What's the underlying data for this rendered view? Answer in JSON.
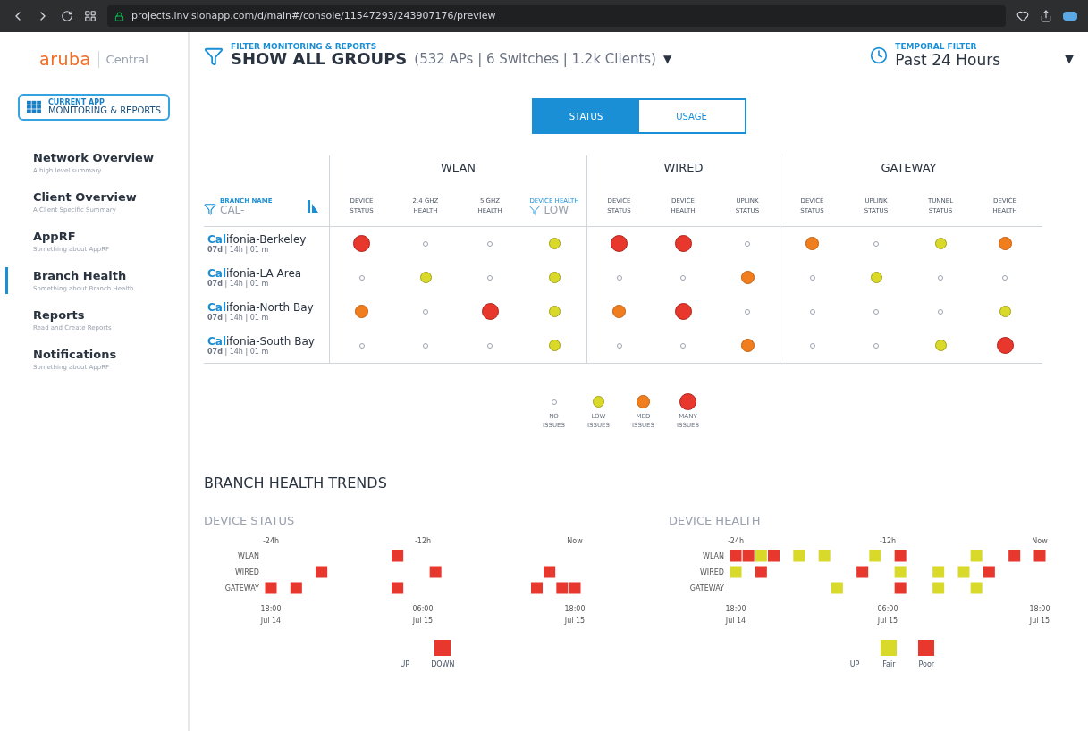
{
  "browser": {
    "url": "projects.invisionapp.com/d/main#/console/11547293/243907176/preview"
  },
  "sidebar": {
    "logo": "aruba",
    "product": "Central",
    "current_app": {
      "label": "CURRENT APP",
      "name": "MONITORING & REPORTS"
    },
    "items": [
      {
        "title": "Network Overview",
        "subtitle": "A high level summary",
        "selected": false
      },
      {
        "title": "Client Overview",
        "subtitle": "A Client Specific Summary",
        "selected": false
      },
      {
        "title": "AppRF",
        "subtitle": "Something about AppRF",
        "selected": false
      },
      {
        "title": "Branch Health",
        "subtitle": "Something about Branch Health",
        "selected": true
      },
      {
        "title": "Reports",
        "subtitle": "Read and Create Reports",
        "selected": false
      },
      {
        "title": "Notifications",
        "subtitle": "Something about AppRF",
        "selected": false
      }
    ]
  },
  "header": {
    "filter_label": "FILTER MONITORING & REPORTS",
    "group": "SHOW ALL GROUPS",
    "counts": "(532 APs | 6 Switches | 1.2k Clients)",
    "caret": "▼",
    "temporal_label": "TEMPORAL FILTER",
    "temporal_value": "Past 24 Hours",
    "menu_caret": "▼"
  },
  "view_tabs": [
    {
      "label": "STATUS",
      "selected": true
    },
    {
      "label": "USAGE",
      "selected": false
    }
  ],
  "table": {
    "branch_filter": {
      "label": "BRANCH NAME",
      "value": "CAL-"
    },
    "groups": [
      {
        "name": "WLAN",
        "columns": [
          {
            "label": "DEVICE STATUS"
          },
          {
            "label": "2.4 GHZ HEALTH"
          },
          {
            "label": "5 GHZ HEALTH"
          },
          {
            "label": "DEVICE HEALTH",
            "filter": "LOW"
          }
        ]
      },
      {
        "name": "WIRED",
        "columns": [
          {
            "label": "DEVICE STATUS"
          },
          {
            "label": "DEVICE HEALTH"
          },
          {
            "label": "UPLINK STATUS"
          }
        ]
      },
      {
        "name": "GATEWAY",
        "columns": [
          {
            "label": "DEVICE STATUS"
          },
          {
            "label": "UPLINK STATUS"
          },
          {
            "label": "TUNNEL STATUS"
          },
          {
            "label": "DEVICE HEALTH"
          }
        ]
      }
    ],
    "rows": [
      {
        "match": "Cal",
        "rest": "ifonia-Berkeley",
        "uptime": "**07d** | 14h | 01 m",
        "cells": [
          {
            "kind": "many"
          },
          {
            "kind": "none"
          },
          {
            "kind": "none"
          },
          {
            "kind": "low"
          },
          {
            "kind": "many"
          },
          {
            "kind": "many"
          },
          {
            "kind": "none"
          },
          {
            "kind": "med"
          },
          {
            "kind": "none"
          },
          {
            "kind": "low"
          },
          {
            "kind": "med"
          }
        ]
      },
      {
        "match": "Cal",
        "rest": "ifonia-LA Area",
        "uptime": "**07d** | 14h | 01 m",
        "cells": [
          {
            "kind": "none"
          },
          {
            "kind": "low"
          },
          {
            "kind": "none"
          },
          {
            "kind": "low"
          },
          {
            "kind": "none"
          },
          {
            "kind": "none"
          },
          {
            "kind": "med"
          },
          {
            "kind": "none"
          },
          {
            "kind": "low"
          },
          {
            "kind": "none"
          },
          {
            "kind": "none"
          }
        ]
      },
      {
        "match": "Cal",
        "rest": "ifonia-North Bay",
        "uptime": "**07d** | 14h | 01 m",
        "cells": [
          {
            "kind": "med"
          },
          {
            "kind": "none"
          },
          {
            "kind": "many"
          },
          {
            "kind": "low"
          },
          {
            "kind": "med"
          },
          {
            "kind": "many"
          },
          {
            "kind": "none"
          },
          {
            "kind": "none"
          },
          {
            "kind": "none"
          },
          {
            "kind": "none"
          },
          {
            "kind": "low"
          }
        ]
      },
      {
        "match": "Cal",
        "rest": "ifonia-South Bay",
        "uptime": "**07d** | 14h | 01 m",
        "cells": [
          {
            "kind": "none"
          },
          {
            "kind": "none"
          },
          {
            "kind": "none"
          },
          {
            "kind": "low"
          },
          {
            "kind": "none"
          },
          {
            "kind": "none"
          },
          {
            "kind": "med"
          },
          {
            "kind": "none"
          },
          {
            "kind": "none"
          },
          {
            "kind": "low"
          },
          {
            "kind": "many"
          }
        ]
      }
    ]
  },
  "legend": [
    {
      "kind": "none",
      "label": "NO ISSUES"
    },
    {
      "kind": "low",
      "label": "LOW ISSUES"
    },
    {
      "kind": "med",
      "label": "MED ISSUES"
    },
    {
      "kind": "many",
      "label": "MANY ISSUES"
    }
  ],
  "trends": {
    "title": "BRANCH HEALTH TRENDS",
    "charts": [
      {
        "title": "DEVICE STATUS",
        "top_labels": [
          "-24h",
          "-12h",
          "Now"
        ],
        "bottom_labels": [
          {
            "time": "18:00",
            "date": "Jul 14"
          },
          {
            "time": "06:00",
            "date": "Jul 15"
          },
          {
            "time": "18:00",
            "date": "Jul 15"
          }
        ],
        "rows": [
          {
            "label": "WLAN",
            "cells": [
              {
                "kind": "up"
              },
              {
                "kind": "up"
              },
              {
                "kind": "up"
              },
              {
                "kind": "up"
              },
              {
                "kind": "up"
              },
              {
                "kind": "up"
              },
              {
                "kind": "up"
              },
              {
                "kind": "up"
              },
              {
                "kind": "up"
              },
              {
                "kind": "up"
              },
              {
                "kind": "down"
              },
              {
                "kind": "up"
              },
              {
                "kind": "up"
              },
              {
                "kind": "up"
              },
              {
                "kind": "up"
              },
              {
                "kind": "up"
              },
              {
                "kind": "up"
              },
              {
                "kind": "up"
              },
              {
                "kind": "up"
              },
              {
                "kind": "up"
              },
              {
                "kind": "up"
              },
              {
                "kind": "up"
              },
              {
                "kind": "up"
              },
              {
                "kind": "up"
              },
              {
                "kind": "up"
              }
            ]
          },
          {
            "label": "WIRED",
            "cells": [
              {
                "kind": "up"
              },
              {
                "kind": "up"
              },
              {
                "kind": "up"
              },
              {
                "kind": "up"
              },
              {
                "kind": "down"
              },
              {
                "kind": "up"
              },
              {
                "kind": "up"
              },
              {
                "kind": "up"
              },
              {
                "kind": "up"
              },
              {
                "kind": "up"
              },
              {
                "kind": "up"
              },
              {
                "kind": "up"
              },
              {
                "kind": "up"
              },
              {
                "kind": "down"
              },
              {
                "kind": "up"
              },
              {
                "kind": "up"
              },
              {
                "kind": "up"
              },
              {
                "kind": "up"
              },
              {
                "kind": "up"
              },
              {
                "kind": "up"
              },
              {
                "kind": "up"
              },
              {
                "kind": "up"
              },
              {
                "kind": "down"
              },
              {
                "kind": "up"
              },
              {
                "kind": "up"
              }
            ]
          },
          {
            "label": "GATEWAY",
            "cells": [
              {
                "kind": "down"
              },
              {
                "kind": "up"
              },
              {
                "kind": "down"
              },
              {
                "kind": "up"
              },
              {
                "kind": "up"
              },
              {
                "kind": "up"
              },
              {
                "kind": "up"
              },
              {
                "kind": "up"
              },
              {
                "kind": "up"
              },
              {
                "kind": "up"
              },
              {
                "kind": "down"
              },
              {
                "kind": "up"
              },
              {
                "kind": "up"
              },
              {
                "kind": "up"
              },
              {
                "kind": "up"
              },
              {
                "kind": "up"
              },
              {
                "kind": "up"
              },
              {
                "kind": "up"
              },
              {
                "kind": "up"
              },
              {
                "kind": "up"
              },
              {
                "kind": "up"
              },
              {
                "kind": "down"
              },
              {
                "kind": "up"
              },
              {
                "kind": "down"
              },
              {
                "kind": "down"
              }
            ]
          }
        ],
        "legend": [
          {
            "kind": "up",
            "label": "UP"
          },
          {
            "kind": "down",
            "label": "DOWN"
          }
        ]
      },
      {
        "title": "DEVICE HEALTH",
        "top_labels": [
          "-24h",
          "-12h",
          "Now"
        ],
        "bottom_labels": [
          {
            "time": "18:00",
            "date": "Jul 14"
          },
          {
            "time": "06:00",
            "date": "Jul 15"
          },
          {
            "time": "18:00",
            "date": "Jul 15"
          }
        ],
        "rows": [
          {
            "label": "WLAN",
            "cells": [
              {
                "kind": "poor"
              },
              {
                "kind": "poor"
              },
              {
                "kind": "fair"
              },
              {
                "kind": "poor"
              },
              {
                "kind": "up"
              },
              {
                "kind": "fair"
              },
              {
                "kind": "up"
              },
              {
                "kind": "fair"
              },
              {
                "kind": "up"
              },
              {
                "kind": "up"
              },
              {
                "kind": "up"
              },
              {
                "kind": "fair"
              },
              {
                "kind": "up"
              },
              {
                "kind": "poor"
              },
              {
                "kind": "up"
              },
              {
                "kind": "up"
              },
              {
                "kind": "up"
              },
              {
                "kind": "up"
              },
              {
                "kind": "up"
              },
              {
                "kind": "fair"
              },
              {
                "kind": "up"
              },
              {
                "kind": "up"
              },
              {
                "kind": "poor"
              },
              {
                "kind": "up"
              },
              {
                "kind": "poor"
              }
            ]
          },
          {
            "label": "WIRED",
            "cells": [
              {
                "kind": "fair"
              },
              {
                "kind": "up"
              },
              {
                "kind": "poor"
              },
              {
                "kind": "up"
              },
              {
                "kind": "up"
              },
              {
                "kind": "up"
              },
              {
                "kind": "up"
              },
              {
                "kind": "up"
              },
              {
                "kind": "up"
              },
              {
                "kind": "up"
              },
              {
                "kind": "poor"
              },
              {
                "kind": "up"
              },
              {
                "kind": "up"
              },
              {
                "kind": "fair"
              },
              {
                "kind": "up"
              },
              {
                "kind": "up"
              },
              {
                "kind": "fair"
              },
              {
                "kind": "up"
              },
              {
                "kind": "fair"
              },
              {
                "kind": "up"
              },
              {
                "kind": "poor"
              },
              {
                "kind": "up"
              },
              {
                "kind": "up"
              },
              {
                "kind": "up"
              },
              {
                "kind": "up"
              }
            ]
          },
          {
            "label": "GATEWAY",
            "cells": [
              {
                "kind": "up"
              },
              {
                "kind": "up"
              },
              {
                "kind": "up"
              },
              {
                "kind": "up"
              },
              {
                "kind": "up"
              },
              {
                "kind": "up"
              },
              {
                "kind": "up"
              },
              {
                "kind": "up"
              },
              {
                "kind": "fair"
              },
              {
                "kind": "up"
              },
              {
                "kind": "up"
              },
              {
                "kind": "up"
              },
              {
                "kind": "up"
              },
              {
                "kind": "poor"
              },
              {
                "kind": "up"
              },
              {
                "kind": "up"
              },
              {
                "kind": "fair"
              },
              {
                "kind": "up"
              },
              {
                "kind": "up"
              },
              {
                "kind": "fair"
              },
              {
                "kind": "up"
              },
              {
                "kind": "up"
              },
              {
                "kind": "up"
              },
              {
                "kind": "up"
              },
              {
                "kind": "up"
              }
            ]
          }
        ],
        "legend": [
          {
            "kind": "up",
            "label": "UP"
          },
          {
            "kind": "fair",
            "label": "Fair"
          },
          {
            "kind": "poor",
            "label": "Poor"
          }
        ]
      }
    ]
  }
}
